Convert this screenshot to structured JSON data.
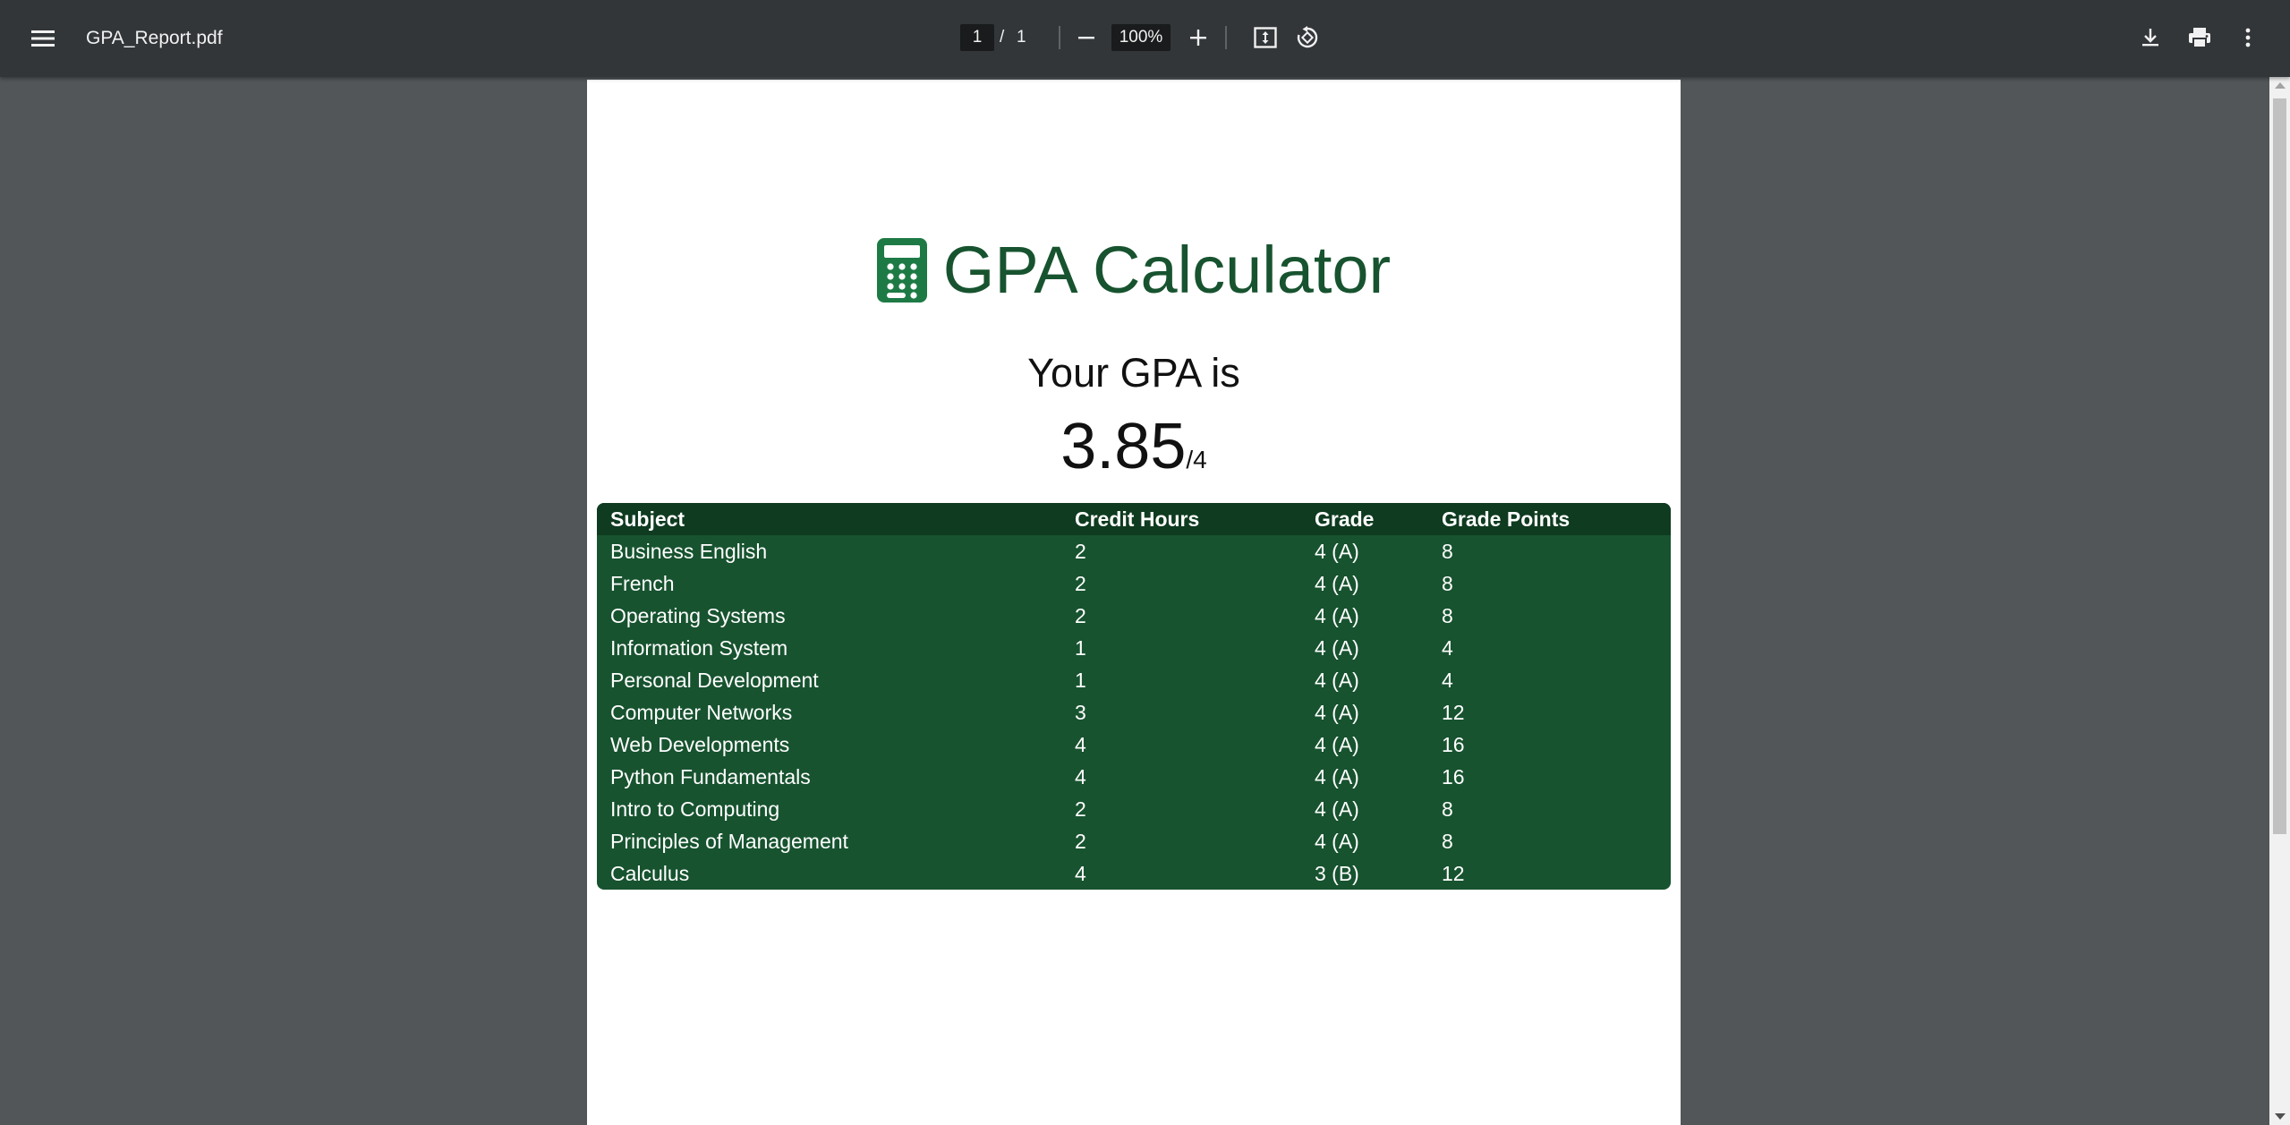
{
  "toolbar": {
    "title": "GPA_Report.pdf",
    "page_current": "1",
    "page_separator": "/",
    "page_total": "1",
    "zoom": "100%",
    "icons": [
      "menu-icon",
      "minus-icon",
      "plus-icon",
      "fit-page-icon",
      "rotate-icon",
      "download-icon",
      "print-icon",
      "more-vert-icon"
    ]
  },
  "document": {
    "heading": "GPA Calculator",
    "heading_icon": "calculator-icon",
    "gpa_label": "Your GPA is",
    "gpa_value": "3.85",
    "gpa_scale": "/4",
    "colors": {
      "accent": "#17532f",
      "header_row": "#0f3b20",
      "icon": "#1e7a45"
    },
    "table": {
      "headers": [
        "Subject",
        "Credit Hours",
        "Grade",
        "Grade Points"
      ],
      "rows": [
        [
          "Business English",
          "2",
          "4 (A)",
          "8"
        ],
        [
          "French",
          "2",
          "4 (A)",
          "8"
        ],
        [
          "Operating Systems",
          "2",
          "4 (A)",
          "8"
        ],
        [
          "Information System",
          "1",
          "4 (A)",
          "4"
        ],
        [
          "Personal Development",
          "1",
          "4 (A)",
          "4"
        ],
        [
          "Computer Networks",
          "3",
          "4 (A)",
          "12"
        ],
        [
          "Web Developments",
          "4",
          "4 (A)",
          "16"
        ],
        [
          "Python Fundamentals",
          "4",
          "4 (A)",
          "16"
        ],
        [
          "Intro to Computing",
          "2",
          "4 (A)",
          "8"
        ],
        [
          "Principles of Management",
          "2",
          "4 (A)",
          "8"
        ],
        [
          "Calculus",
          "4",
          "3 (B)",
          "12"
        ]
      ]
    }
  }
}
